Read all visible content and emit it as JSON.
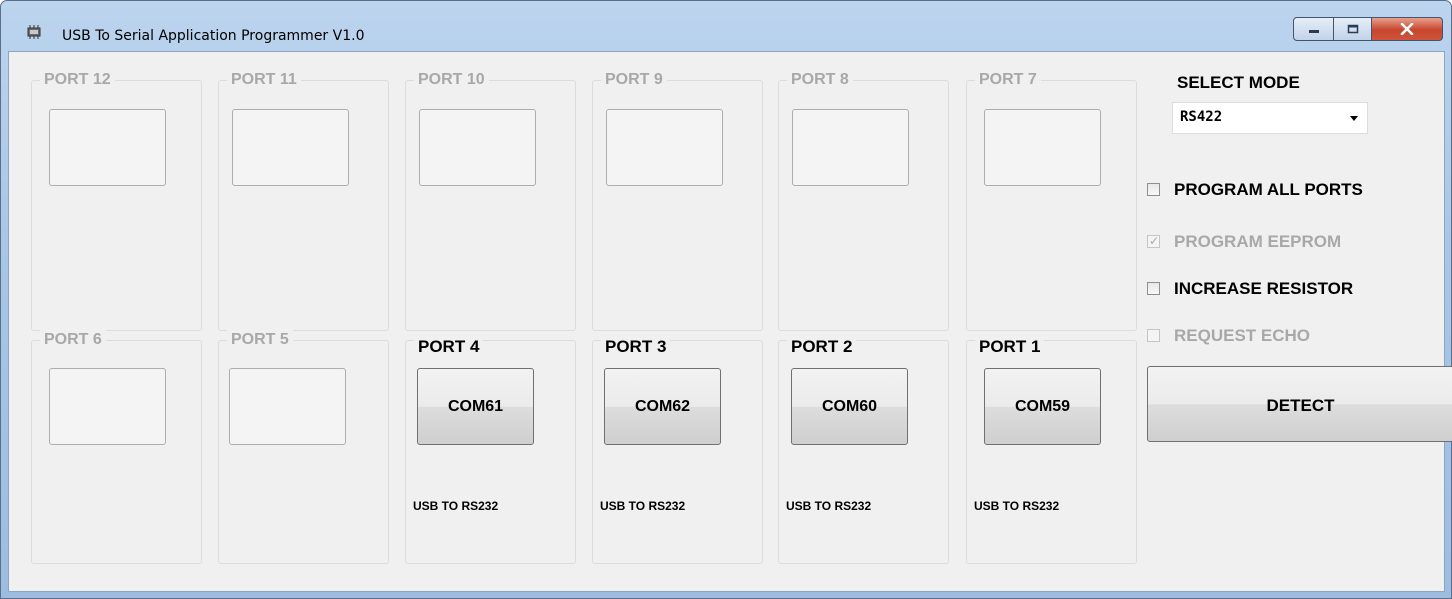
{
  "window": {
    "title": "USB To Serial Application Programmer V1.0",
    "icon": "app-chip-icon",
    "controls": [
      "minimize-icon",
      "maximize-icon",
      "close-icon"
    ]
  },
  "ports_top": [
    {
      "name": "PORT 12",
      "enabled": false,
      "com": "",
      "type": ""
    },
    {
      "name": "PORT 11",
      "enabled": false,
      "com": "",
      "type": ""
    },
    {
      "name": "PORT 10",
      "enabled": false,
      "com": "",
      "type": ""
    },
    {
      "name": "PORT 9",
      "enabled": false,
      "com": "",
      "type": ""
    },
    {
      "name": "PORT 8",
      "enabled": false,
      "com": "",
      "type": ""
    },
    {
      "name": "PORT 7",
      "enabled": false,
      "com": "",
      "type": ""
    }
  ],
  "ports_bottom": [
    {
      "name": "PORT 6",
      "enabled": false,
      "com": "",
      "type": ""
    },
    {
      "name": "PORT 5",
      "enabled": false,
      "com": "",
      "type": ""
    },
    {
      "name": "PORT 4",
      "enabled": true,
      "com": "COM61",
      "type": "USB TO RS232"
    },
    {
      "name": "PORT 3",
      "enabled": true,
      "com": "COM62",
      "type": "USB TO RS232"
    },
    {
      "name": "PORT 2",
      "enabled": true,
      "com": "COM60",
      "type": "USB TO RS232"
    },
    {
      "name": "PORT 1",
      "enabled": true,
      "com": "COM59",
      "type": "USB TO RS232"
    }
  ],
  "mode": {
    "label": "SELECT MODE",
    "value": "RS422"
  },
  "options": {
    "program_all": {
      "label": "PROGRAM ALL PORTS",
      "checked": false,
      "enabled": true
    },
    "program_eeprom": {
      "label": "PROGRAM EEPROM",
      "checked": true,
      "enabled": false
    },
    "increase_resistor": {
      "label": "INCREASE RESISTOR",
      "checked": false,
      "enabled": true
    },
    "request_echo": {
      "label": "REQUEST ECHO",
      "checked": false,
      "enabled": false
    }
  },
  "detect": {
    "label": "DETECT"
  },
  "colors": {
    "titlebar": "#a9c6e6",
    "client_bg": "#f0f0f0",
    "disabled_text": "#a8a8a8",
    "close_button": "#c6452d"
  }
}
